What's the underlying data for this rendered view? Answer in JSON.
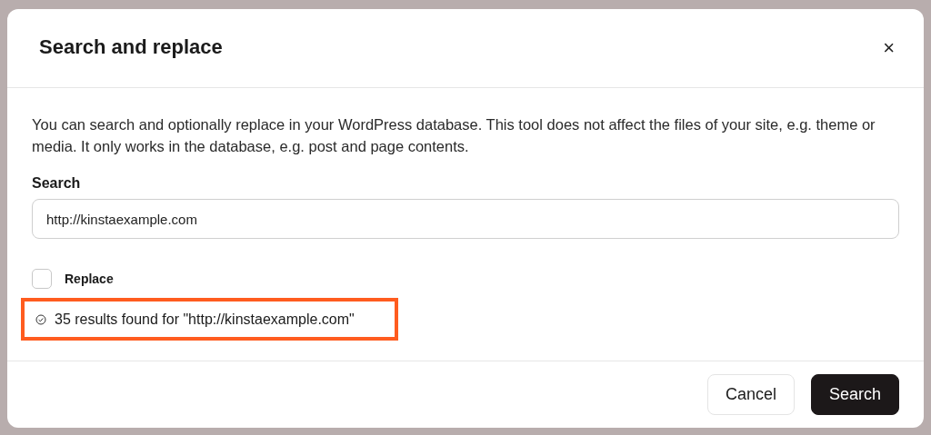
{
  "dialog": {
    "title": "Search and replace",
    "close_label": "×",
    "description": "You can search and optionally replace in your WordPress database. This tool does not affect the files of your site, e.g. theme or media. It only works in the database, e.g. post and page contents.",
    "search": {
      "label": "Search",
      "value": "http://kinstaexample.com"
    },
    "replace": {
      "label": "Replace",
      "checked": false
    },
    "result": {
      "text": "35 results found for \"http://kinstaexample.com\"",
      "highlighted": true
    },
    "buttons": [
      {
        "label": "Cancel",
        "kind": "secondary"
      },
      {
        "label": "Search",
        "kind": "primary"
      }
    ]
  }
}
